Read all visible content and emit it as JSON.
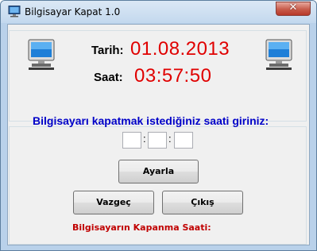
{
  "window": {
    "title": "Bilgisayar Kapat 1.0",
    "close_glyph": "✕"
  },
  "clock": {
    "date_label": "Tarih:",
    "date_value": "01.08.2013",
    "time_label": "Saat:",
    "time_value": "03:57:50"
  },
  "shutdown": {
    "prompt": "Bilgisayarı kapatmak istediğiniz saati giriniz:",
    "hour": "",
    "minute": "",
    "second": "",
    "separator": ":",
    "set_button": "Ayarla",
    "cancel_button": "Vazgeç",
    "exit_button": "Çıkış",
    "status_label": "Bilgisayarın Kapanma Saati:"
  },
  "colors": {
    "clock_value": "#e00000",
    "prompt": "#0000c8",
    "status": "#c00000"
  },
  "icons": {
    "title": "computer-icon",
    "left": "computer-icon",
    "right": "computer-icon"
  }
}
